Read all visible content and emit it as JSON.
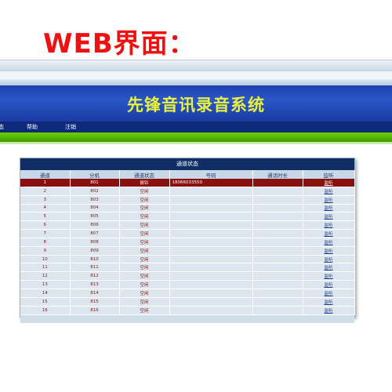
{
  "caption": "WEB界面：",
  "app": {
    "title": "先锋音讯录音系统",
    "menu": [
      "态",
      "帮助",
      "注销"
    ]
  },
  "panel": {
    "title": "通道状态",
    "columns": [
      "通道",
      "分机",
      "通道状态",
      "号码",
      "通话时长",
      "监听"
    ],
    "rows": [
      {
        "channel": "1",
        "ext": "801",
        "status": "振铃",
        "number": "18066033550",
        "duration": "",
        "listen": "监听",
        "active": true
      },
      {
        "channel": "2",
        "ext": "802",
        "status": "空闲",
        "number": "",
        "duration": "",
        "listen": "监听",
        "active": false
      },
      {
        "channel": "3",
        "ext": "803",
        "status": "空闲",
        "number": "",
        "duration": "",
        "listen": "监听",
        "active": false
      },
      {
        "channel": "4",
        "ext": "804",
        "status": "空闲",
        "number": "",
        "duration": "",
        "listen": "监听",
        "active": false
      },
      {
        "channel": "5",
        "ext": "805",
        "status": "空闲",
        "number": "",
        "duration": "",
        "listen": "监听",
        "active": false
      },
      {
        "channel": "6",
        "ext": "806",
        "status": "空闲",
        "number": "",
        "duration": "",
        "listen": "监听",
        "active": false
      },
      {
        "channel": "7",
        "ext": "807",
        "status": "空闲",
        "number": "",
        "duration": "",
        "listen": "监听",
        "active": false
      },
      {
        "channel": "8",
        "ext": "808",
        "status": "空闲",
        "number": "",
        "duration": "",
        "listen": "监听",
        "active": false
      },
      {
        "channel": "9",
        "ext": "809",
        "status": "空闲",
        "number": "",
        "duration": "",
        "listen": "监听",
        "active": false
      },
      {
        "channel": "10",
        "ext": "810",
        "status": "空闲",
        "number": "",
        "duration": "",
        "listen": "监听",
        "active": false
      },
      {
        "channel": "11",
        "ext": "811",
        "status": "空闲",
        "number": "",
        "duration": "",
        "listen": "监听",
        "active": false
      },
      {
        "channel": "12",
        "ext": "812",
        "status": "空闲",
        "number": "",
        "duration": "",
        "listen": "监听",
        "active": false
      },
      {
        "channel": "13",
        "ext": "813",
        "status": "空闲",
        "number": "",
        "duration": "",
        "listen": "监听",
        "active": false
      },
      {
        "channel": "14",
        "ext": "814",
        "status": "空闲",
        "number": "",
        "duration": "",
        "listen": "监听",
        "active": false
      },
      {
        "channel": "15",
        "ext": "815",
        "status": "空闲",
        "number": "",
        "duration": "",
        "listen": "监听",
        "active": false
      },
      {
        "channel": "16",
        "ext": "816",
        "status": "空闲",
        "number": "",
        "duration": "",
        "listen": "监听",
        "active": false
      }
    ]
  },
  "colors": {
    "caption": "#ee1111",
    "banner": "#1e3fae",
    "title_text": "#e9f23b",
    "menubar": "#0d2a7a",
    "greenbar": "#5bbf00",
    "panel_header": "#0f2f64",
    "active_row": "#8a0f0f"
  }
}
